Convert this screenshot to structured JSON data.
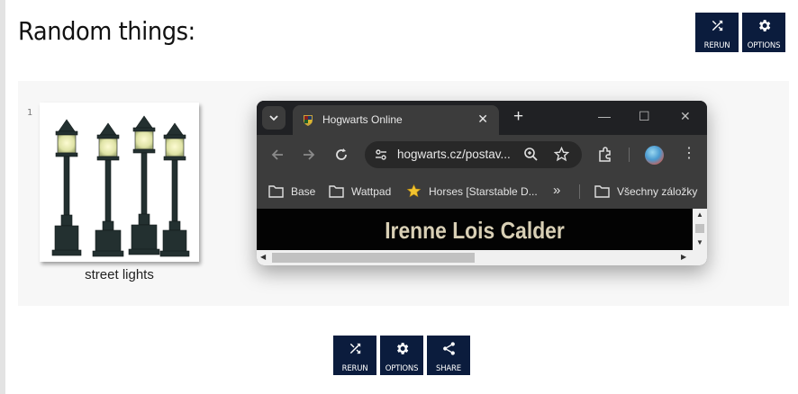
{
  "page": {
    "title": "Random things:"
  },
  "top_buttons": {
    "rerun": "RERUN",
    "options": "OPTIONS"
  },
  "item": {
    "index": "1",
    "caption": "street lights"
  },
  "browser": {
    "tab_title": "Hogwarts Online",
    "tab_close": "✕",
    "new_tab": "+",
    "minimize": "—",
    "maximize": "☐",
    "close": "✕",
    "address": "hogwarts.cz/postav...",
    "kebab": "⋮",
    "bookmarks": [
      {
        "label": "Base",
        "icon": "folder-icon"
      },
      {
        "label": "Wattpad",
        "icon": "folder-icon"
      },
      {
        "label": "Horses [Starstable D...",
        "icon": "star-favicon"
      }
    ],
    "bookmarks_overflow": "»",
    "all_bookmarks": "Všechny záložky",
    "page_heading": "Irenne Lois Calder",
    "scroll_up": "▲",
    "scroll_down": "▼",
    "scroll_left": "◀",
    "scroll_right": "▶"
  },
  "bottom_buttons": {
    "rerun": "RERUN",
    "options": "OPTIONS",
    "share": "SHARE"
  },
  "colors": {
    "button_bg": "#0b1c3d",
    "panel_bg": "#f7f7f7",
    "browser_bg": "#3c3c3c"
  }
}
